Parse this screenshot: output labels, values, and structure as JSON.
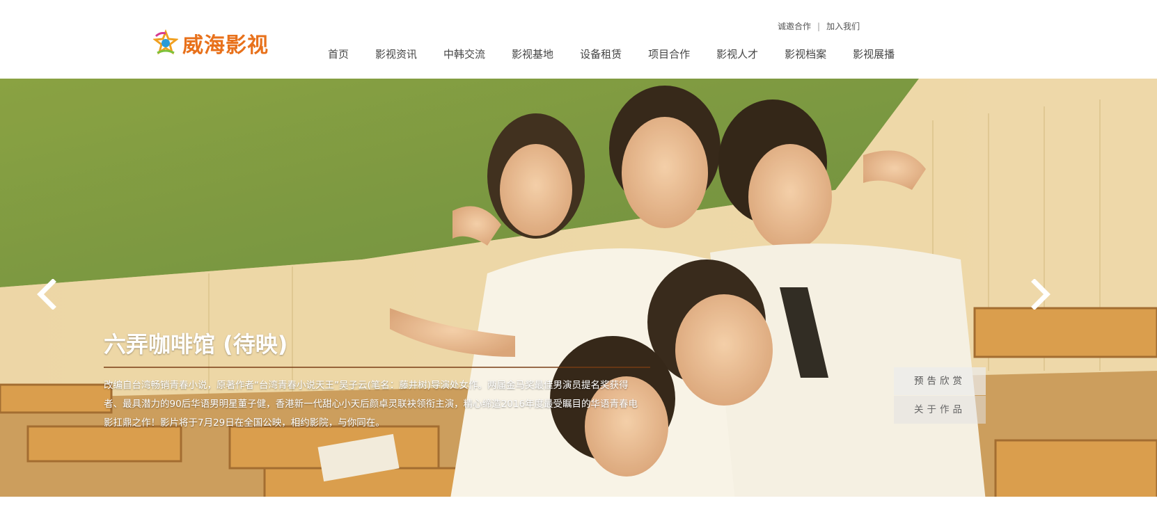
{
  "brand": {
    "logo_text": "威海影视",
    "logo_icon": "film-reel-star-icon"
  },
  "top_links": {
    "cooperate": "诚邀合作",
    "separator": "|",
    "join": "加入我们"
  },
  "nav": [
    {
      "label": "首页"
    },
    {
      "label": "影视资讯"
    },
    {
      "label": "中韩交流"
    },
    {
      "label": "影视基地"
    },
    {
      "label": "设备租赁"
    },
    {
      "label": "项目合作"
    },
    {
      "label": "影视人才"
    },
    {
      "label": "影视档案"
    },
    {
      "label": "影视展播"
    }
  ],
  "slider": {
    "title": "六弄咖啡馆 (待映)",
    "description": "改编自台湾畅销青春小说，原著作者“台湾青春小说天王”吴子云(笔名：藤井树)导演处女作。两届金马奖最佳男演员提名奖获得者、最具潜力的90后华语男明星董子健，香港新一代甜心小天后颜卓灵联袂领衔主演，精心缔造2016年度最受瞩目的华语青春电影扛鼎之作！影片将于7月29日在全国公映，相约影院，与你同在。",
    "buttons": {
      "trailer": "预告欣赏",
      "about": "关于作品"
    },
    "prev_icon": "chevron-left-icon",
    "next_icon": "chevron-right-icon"
  },
  "colors": {
    "brand_orange": "#e8711b",
    "nav_text": "#444444"
  }
}
